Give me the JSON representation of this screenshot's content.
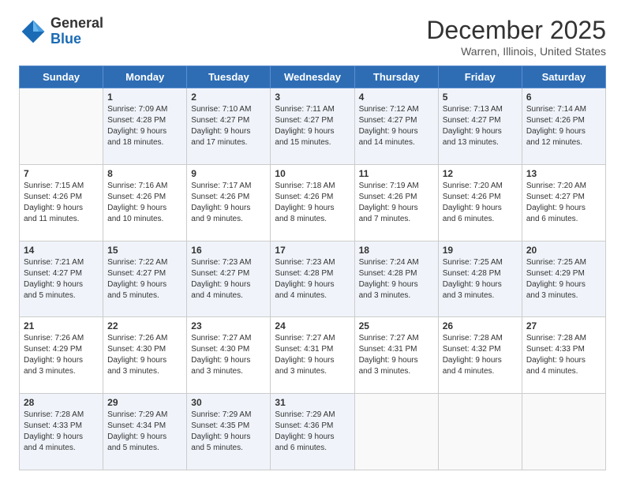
{
  "header": {
    "logo_general": "General",
    "logo_blue": "Blue",
    "month_title": "December 2025",
    "location": "Warren, Illinois, United States"
  },
  "days_of_week": [
    "Sunday",
    "Monday",
    "Tuesday",
    "Wednesday",
    "Thursday",
    "Friday",
    "Saturday"
  ],
  "weeks": [
    [
      {
        "day": "",
        "info": ""
      },
      {
        "day": "1",
        "info": "Sunrise: 7:09 AM\nSunset: 4:28 PM\nDaylight: 9 hours\nand 18 minutes."
      },
      {
        "day": "2",
        "info": "Sunrise: 7:10 AM\nSunset: 4:27 PM\nDaylight: 9 hours\nand 17 minutes."
      },
      {
        "day": "3",
        "info": "Sunrise: 7:11 AM\nSunset: 4:27 PM\nDaylight: 9 hours\nand 15 minutes."
      },
      {
        "day": "4",
        "info": "Sunrise: 7:12 AM\nSunset: 4:27 PM\nDaylight: 9 hours\nand 14 minutes."
      },
      {
        "day": "5",
        "info": "Sunrise: 7:13 AM\nSunset: 4:27 PM\nDaylight: 9 hours\nand 13 minutes."
      },
      {
        "day": "6",
        "info": "Sunrise: 7:14 AM\nSunset: 4:26 PM\nDaylight: 9 hours\nand 12 minutes."
      }
    ],
    [
      {
        "day": "7",
        "info": "Sunrise: 7:15 AM\nSunset: 4:26 PM\nDaylight: 9 hours\nand 11 minutes."
      },
      {
        "day": "8",
        "info": "Sunrise: 7:16 AM\nSunset: 4:26 PM\nDaylight: 9 hours\nand 10 minutes."
      },
      {
        "day": "9",
        "info": "Sunrise: 7:17 AM\nSunset: 4:26 PM\nDaylight: 9 hours\nand 9 minutes."
      },
      {
        "day": "10",
        "info": "Sunrise: 7:18 AM\nSunset: 4:26 PM\nDaylight: 9 hours\nand 8 minutes."
      },
      {
        "day": "11",
        "info": "Sunrise: 7:19 AM\nSunset: 4:26 PM\nDaylight: 9 hours\nand 7 minutes."
      },
      {
        "day": "12",
        "info": "Sunrise: 7:20 AM\nSunset: 4:26 PM\nDaylight: 9 hours\nand 6 minutes."
      },
      {
        "day": "13",
        "info": "Sunrise: 7:20 AM\nSunset: 4:27 PM\nDaylight: 9 hours\nand 6 minutes."
      }
    ],
    [
      {
        "day": "14",
        "info": "Sunrise: 7:21 AM\nSunset: 4:27 PM\nDaylight: 9 hours\nand 5 minutes."
      },
      {
        "day": "15",
        "info": "Sunrise: 7:22 AM\nSunset: 4:27 PM\nDaylight: 9 hours\nand 5 minutes."
      },
      {
        "day": "16",
        "info": "Sunrise: 7:23 AM\nSunset: 4:27 PM\nDaylight: 9 hours\nand 4 minutes."
      },
      {
        "day": "17",
        "info": "Sunrise: 7:23 AM\nSunset: 4:28 PM\nDaylight: 9 hours\nand 4 minutes."
      },
      {
        "day": "18",
        "info": "Sunrise: 7:24 AM\nSunset: 4:28 PM\nDaylight: 9 hours\nand 3 minutes."
      },
      {
        "day": "19",
        "info": "Sunrise: 7:25 AM\nSunset: 4:28 PM\nDaylight: 9 hours\nand 3 minutes."
      },
      {
        "day": "20",
        "info": "Sunrise: 7:25 AM\nSunset: 4:29 PM\nDaylight: 9 hours\nand 3 minutes."
      }
    ],
    [
      {
        "day": "21",
        "info": "Sunrise: 7:26 AM\nSunset: 4:29 PM\nDaylight: 9 hours\nand 3 minutes."
      },
      {
        "day": "22",
        "info": "Sunrise: 7:26 AM\nSunset: 4:30 PM\nDaylight: 9 hours\nand 3 minutes."
      },
      {
        "day": "23",
        "info": "Sunrise: 7:27 AM\nSunset: 4:30 PM\nDaylight: 9 hours\nand 3 minutes."
      },
      {
        "day": "24",
        "info": "Sunrise: 7:27 AM\nSunset: 4:31 PM\nDaylight: 9 hours\nand 3 minutes."
      },
      {
        "day": "25",
        "info": "Sunrise: 7:27 AM\nSunset: 4:31 PM\nDaylight: 9 hours\nand 3 minutes."
      },
      {
        "day": "26",
        "info": "Sunrise: 7:28 AM\nSunset: 4:32 PM\nDaylight: 9 hours\nand 4 minutes."
      },
      {
        "day": "27",
        "info": "Sunrise: 7:28 AM\nSunset: 4:33 PM\nDaylight: 9 hours\nand 4 minutes."
      }
    ],
    [
      {
        "day": "28",
        "info": "Sunrise: 7:28 AM\nSunset: 4:33 PM\nDaylight: 9 hours\nand 4 minutes."
      },
      {
        "day": "29",
        "info": "Sunrise: 7:29 AM\nSunset: 4:34 PM\nDaylight: 9 hours\nand 5 minutes."
      },
      {
        "day": "30",
        "info": "Sunrise: 7:29 AM\nSunset: 4:35 PM\nDaylight: 9 hours\nand 5 minutes."
      },
      {
        "day": "31",
        "info": "Sunrise: 7:29 AM\nSunset: 4:36 PM\nDaylight: 9 hours\nand 6 minutes."
      },
      {
        "day": "",
        "info": ""
      },
      {
        "day": "",
        "info": ""
      },
      {
        "day": "",
        "info": ""
      }
    ]
  ]
}
